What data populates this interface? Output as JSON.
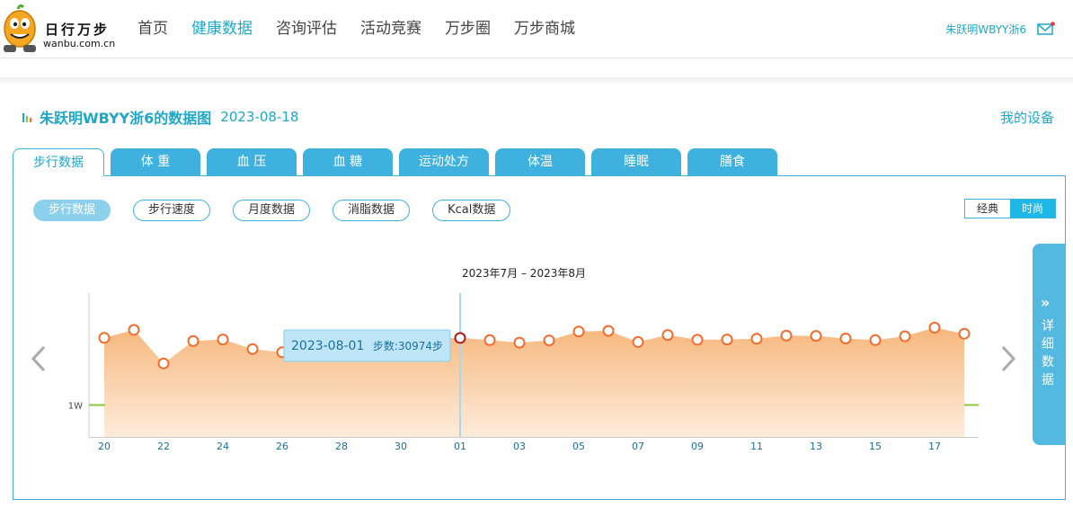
{
  "header": {
    "logo_text": "日行万步",
    "logo_sub": "wanbu.com.cn",
    "nav": [
      "首页",
      "健康数据",
      "咨询评估",
      "活动竞赛",
      "万步圈",
      "万步商城"
    ],
    "active_nav": 1,
    "user_name": "朱跃明WBYY浙6",
    "mail_icon": "mail-icon"
  },
  "page": {
    "title": "朱跃明WBYY浙6的数据图",
    "date": "2023-08-18",
    "device_link": "我的设备"
  },
  "tabs": [
    "步行数据",
    "体 重",
    "血 压",
    "血 糖",
    "运动处方",
    "体温",
    "睡眠",
    "膳食"
  ],
  "subtabs": [
    "步行数据",
    "步行速度",
    "月度数据",
    "消脂数据",
    "Kcal数据"
  ],
  "toggle": [
    "经典",
    "时尚"
  ],
  "detail_tab": {
    "arrows": "»",
    "label": "详细数据"
  },
  "colors": {
    "accent": "#1da8c9",
    "tab": "#3eb1de",
    "area": "#f7b77c",
    "point": "#f26c2d",
    "goal": "#8cc63f"
  },
  "chart_data": {
    "type": "area",
    "title": "2023年7月 – 2023年8月",
    "goal_label": "1W",
    "goal_value": 10000,
    "ylim": [
      0,
      45000
    ],
    "x_ticks": [
      "20",
      "22",
      "24",
      "26",
      "28",
      "30",
      "01",
      "03",
      "05",
      "07",
      "09",
      "11",
      "13",
      "15",
      "17"
    ],
    "x": [
      "07-20",
      "07-21",
      "07-22",
      "07-23",
      "07-24",
      "07-25",
      "07-26",
      "07-27",
      "07-28",
      "07-29",
      "07-30",
      "07-31",
      "08-01",
      "08-02",
      "08-03",
      "08-04",
      "08-05",
      "08-06",
      "08-07",
      "08-08",
      "08-09",
      "08-10",
      "08-11",
      "08-12",
      "08-13",
      "08-14",
      "08-15",
      "08-16",
      "08-17",
      "08-18"
    ],
    "values": [
      31000,
      33500,
      23000,
      30000,
      30500,
      27500,
      26500,
      30500,
      30800,
      30700,
      30600,
      30700,
      30974,
      30300,
      29500,
      30200,
      33000,
      33200,
      29700,
      31900,
      30400,
      30500,
      30700,
      31700,
      31600,
      30800,
      30300,
      31500,
      34200,
      32300
    ],
    "tooltip": {
      "date": "2023-08-01",
      "label": "步数:30974步",
      "index": 12
    }
  }
}
